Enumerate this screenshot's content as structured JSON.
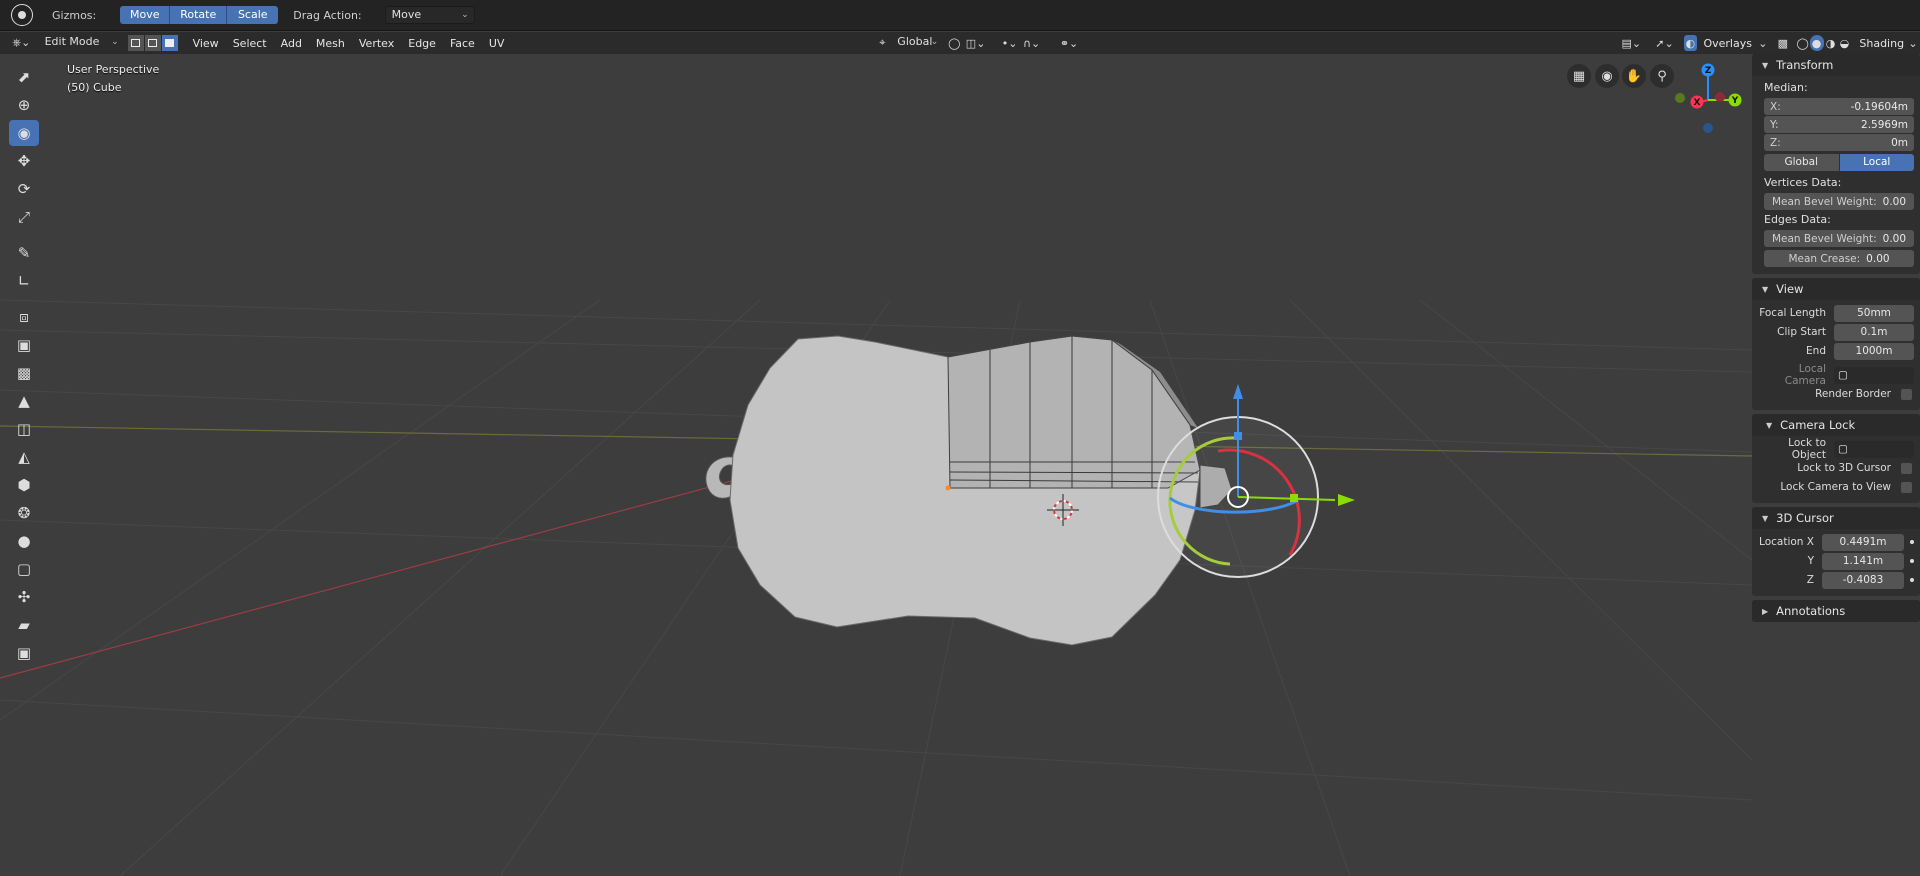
{
  "tool_header": {
    "gizmos_label": "Gizmos:",
    "gizmo_buttons": [
      "Move",
      "Rotate",
      "Scale"
    ],
    "drag_action_label": "Drag Action:",
    "drag_action_value": "Move"
  },
  "viewport_header": {
    "mode": "Edit Mode",
    "menus": [
      "View",
      "Select",
      "Add",
      "Mesh",
      "Vertex",
      "Edge",
      "Face",
      "UV"
    ],
    "transform_orientation": "Global",
    "overlays_label": "Overlays",
    "shading_label": "Shading"
  },
  "overlay": {
    "perspective": "User Perspective",
    "object": "(50) Cube"
  },
  "gizmo_axes": [
    "Z",
    "X",
    "Y"
  ],
  "sidebar": {
    "transform": {
      "title": "Transform",
      "median_label": "Median:",
      "x_label": "X:",
      "x_value": "-0.19604m",
      "y_label": "Y:",
      "y_value": "2.5969m",
      "z_label": "Z:",
      "z_value": "0m",
      "space_options": [
        "Global",
        "Local"
      ],
      "vertices_data_label": "Vertices Data:",
      "mean_bevel_weight_label": "Mean Bevel Weight:",
      "vertex_bevel_weight": "0.00",
      "edges_data_label": "Edges Data:",
      "edge_bevel_weight": "0.00",
      "mean_crease_label": "Mean Crease:",
      "mean_crease": "0.00"
    },
    "view": {
      "title": "View",
      "focal_length_label": "Focal Length",
      "focal_length": "50mm",
      "clip_start_label": "Clip Start",
      "clip_start": "0.1m",
      "end_label": "End",
      "end": "1000m",
      "local_camera_label": "Local Camera",
      "render_border_label": "Render Border"
    },
    "camera_lock": {
      "title": "Camera Lock",
      "lock_to_object_label": "Lock to Object",
      "lock_to_3d_cursor_label": "Lock to 3D Cursor",
      "lock_camera_to_view_label": "Lock Camera to View"
    },
    "cursor_3d": {
      "title": "3D Cursor",
      "location_x_label": "Location X",
      "location_x": "0.4491m",
      "y_label": "Y",
      "location_y": "1.141m",
      "z_label": "Z",
      "location_z": "-0.4083"
    },
    "annotations": {
      "title": "Annotations"
    }
  },
  "colors": {
    "accent": "#4772b3",
    "x_axis": "#ff3352",
    "y_axis": "#8bdc00",
    "z_axis": "#2890ff",
    "background": "#3d3d3d"
  }
}
